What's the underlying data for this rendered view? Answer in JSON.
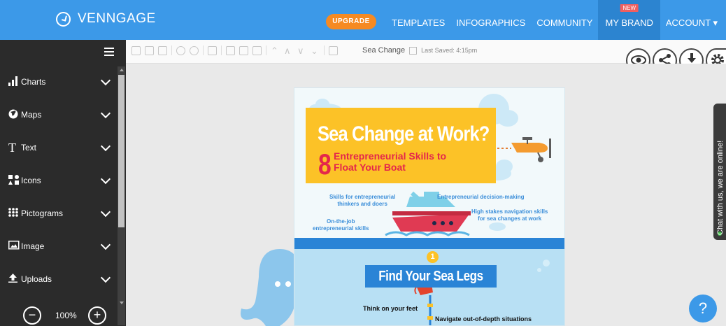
{
  "nav": {
    "brand": "VENNGAGE",
    "upgrade": "UPGRADE",
    "links": [
      "TEMPLATES",
      "INFOGRAPHICS",
      "COMMUNITY"
    ],
    "my_brand": "MY BRAND",
    "new_badge": "NEW",
    "account": "ACCOUNT ▾"
  },
  "sidebar": {
    "items": [
      {
        "label": "Charts",
        "icon": "bar-chart-icon"
      },
      {
        "label": "Maps",
        "icon": "globe-icon"
      },
      {
        "label": "Text",
        "icon": "text-icon"
      },
      {
        "label": "Icons",
        "icon": "icons-icon"
      },
      {
        "label": "Pictograms",
        "icon": "pictogram-grid-icon"
      },
      {
        "label": "Image",
        "icon": "image-icon"
      },
      {
        "label": "Uploads",
        "icon": "upload-icon"
      }
    ],
    "zoom": "100%",
    "zoom_out": "−",
    "zoom_in": "+"
  },
  "toolbar": {
    "doc_title": "Sea Change",
    "last_saved": "Last Saved: 4:15pm"
  },
  "infographic": {
    "headline": "Sea Change at Work?",
    "number": "8",
    "subtitle_1": "Entrepreneurial Skills to",
    "subtitle_2": "Float Your Boat",
    "skills": {
      "s1": "Skills for entrepreneurial",
      "s1b": "thinkers and doers",
      "s2": "Entrepreneurial decision-making",
      "s3": "High stakes navigation skills",
      "s3b": "for sea changes at work",
      "s4": "On-the-job",
      "s4b": "entrepreneurial skills"
    },
    "step_number": "1",
    "section_title": "Find Your Sea Legs",
    "tip_1": "Think on your feet",
    "tip_2": "Navigate out-of-depth situations"
  },
  "chat": {
    "text": "Chat with us, we are online!"
  },
  "help": {
    "label": "?"
  },
  "colors": {
    "nav": "#3c99e8",
    "sidebar": "#2b2b2b",
    "accent_yellow": "#fcc227",
    "accent_red": "#e4274b",
    "orange": "#f68a22"
  }
}
